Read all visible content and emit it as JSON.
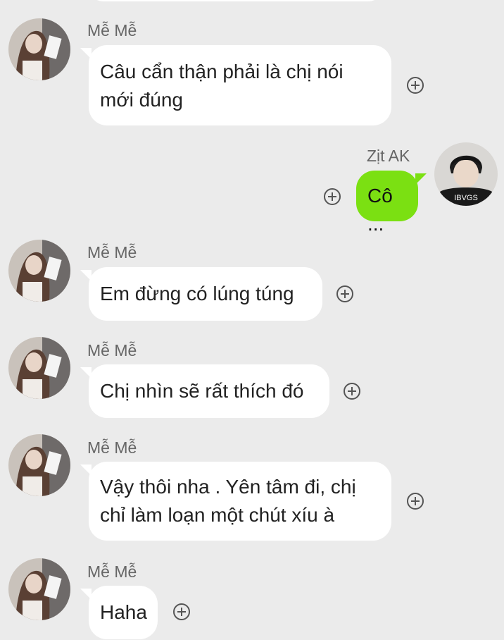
{
  "conversation": {
    "messages": [
      {
        "sender": "Mễ Mễ",
        "side": "left",
        "lines": [
          "Câu cẩn thận phải là chị nói",
          "mới đúng"
        ]
      },
      {
        "sender": "Zịt AK",
        "side": "right",
        "lines": [
          "Cô ..."
        ]
      },
      {
        "sender": "Mễ Mễ",
        "side": "left",
        "lines": [
          "Em đừng có lúng túng"
        ]
      },
      {
        "sender": "Mễ Mễ",
        "side": "left",
        "lines": [
          "Chị nhìn sẽ rất thích  đó"
        ]
      },
      {
        "sender": "Mễ Mễ",
        "side": "left",
        "lines": [
          "Vậy thôi nha . Yên tâm đi, chị",
          "chỉ làm loạn một chút xíu à"
        ]
      },
      {
        "sender": "Mễ Mễ",
        "side": "left",
        "lines": [
          "Haha"
        ]
      }
    ]
  },
  "colors": {
    "background": "#ebebeb",
    "incoming_bubble": "#ffffff",
    "outgoing_bubble": "#7be012"
  },
  "icons": {
    "reaction": "add-circle-icon"
  }
}
